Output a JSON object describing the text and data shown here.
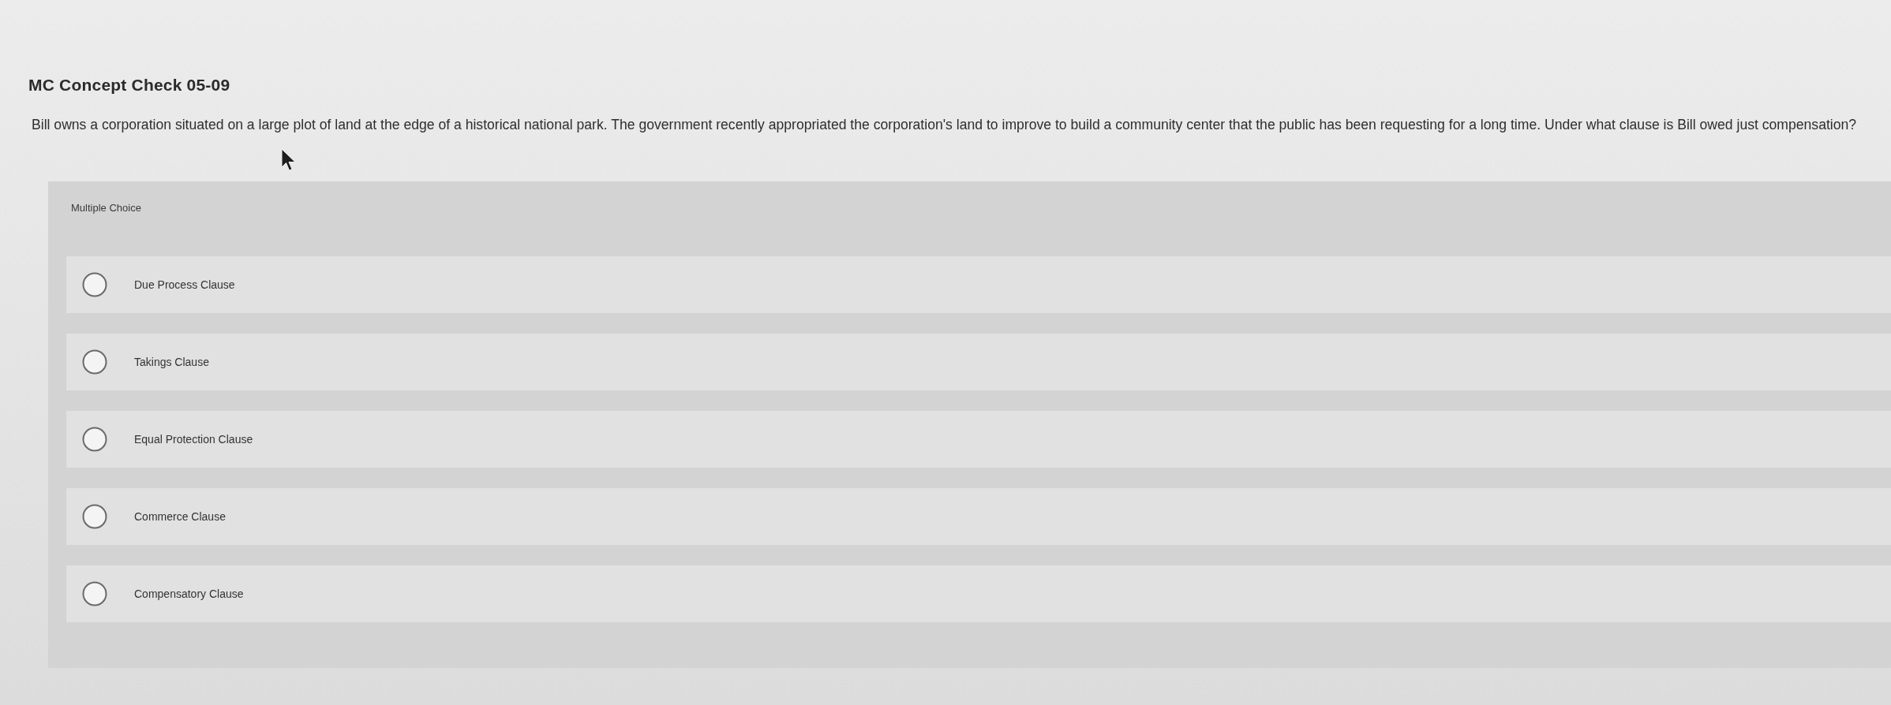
{
  "title": "MC Concept Check 05-09",
  "question": "Bill owns a corporation situated on a large plot of land at the edge of a historical national park. The government recently appropriated the corporation's land to improve to build a community center that the public has been requesting for a long time. Under what clause is Bill owed just compensation?",
  "answer_panel": {
    "heading": "Multiple Choice",
    "options": [
      {
        "label": "Due Process Clause",
        "selected": false
      },
      {
        "label": "Takings Clause",
        "selected": false
      },
      {
        "label": "Equal Protection Clause",
        "selected": false
      },
      {
        "label": "Commerce Clause",
        "selected": false
      },
      {
        "label": "Compensatory Clause",
        "selected": false
      }
    ]
  }
}
